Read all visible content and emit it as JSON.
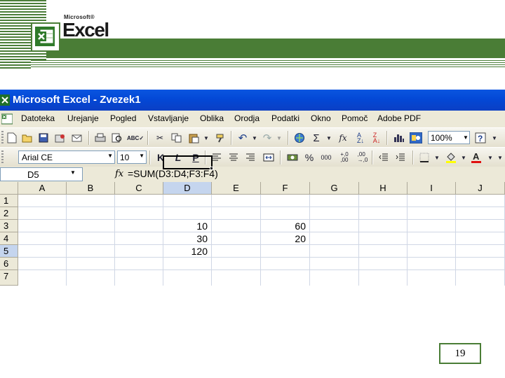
{
  "header": {
    "brand_small": "Microsoft®",
    "brand_large": "Excel"
  },
  "window": {
    "title": "Microsoft Excel - Zvezek1"
  },
  "menu": [
    "Datoteka",
    "Urejanje",
    "Pogled",
    "Vstavljanje",
    "Oblika",
    "Orodja",
    "Podatki",
    "Okno",
    "Pomoč",
    "Adobe PDF"
  ],
  "toolbar": {
    "zoom": "100%",
    "font": "Arial CE",
    "size": "10",
    "bold": "K",
    "italic": "L",
    "underline": "P"
  },
  "formula_bar": {
    "name_box": "D5",
    "fx": "fx",
    "formula": "=SUM(D3:D4;F3:F4)"
  },
  "columns": [
    "A",
    "B",
    "C",
    "D",
    "E",
    "F",
    "G",
    "H",
    "I",
    "J"
  ],
  "rows": [
    "1",
    "2",
    "3",
    "4",
    "5",
    "6",
    "7"
  ],
  "cells": {
    "D3": "10",
    "F3": "60",
    "D4": "30",
    "F4": "20",
    "D5": "120"
  },
  "page_number": "19"
}
